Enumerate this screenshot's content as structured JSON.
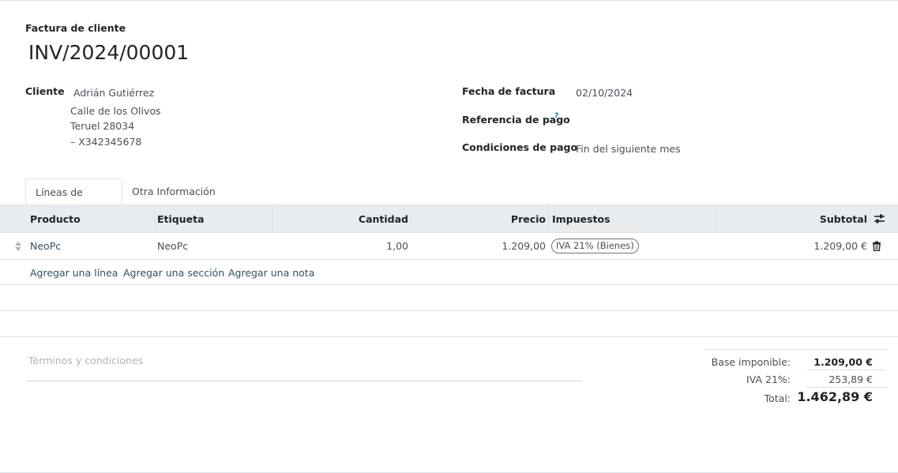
{
  "header": {
    "doc_type": "Factura de cliente",
    "doc_number": "INV/2024/00001"
  },
  "customer": {
    "label": "Cliente",
    "name": "Adrián Gutiérrez",
    "address_line1": "Calle de los Olivos",
    "address_line2": "Teruel 28034",
    "address_line3": "– X342345678"
  },
  "invoice_info": {
    "date_label": "Fecha de factura",
    "date_value": "02/10/2024",
    "payment_ref_label": "Referencia de pago",
    "payment_ref_help": "?",
    "payment_terms_label": "Condiciones de pago",
    "payment_terms_value": "Fin del siguiente mes"
  },
  "tabs": [
    {
      "label": "Líneas de factura",
      "active": true
    },
    {
      "label": "Otra Información",
      "active": false
    }
  ],
  "table": {
    "columns": [
      "Producto",
      "Etiqueta",
      "Cantidad",
      "Precio",
      "Impuestos",
      "Subtotal"
    ],
    "rows": [
      {
        "product": "NeoPc",
        "label": "NeoPc",
        "quantity": "1,00",
        "price": "1.209,00",
        "tax": "IVA 21% (Bienes)",
        "subtotal": "1.209,00 €"
      }
    ],
    "actions": [
      "Agregar una línea",
      "Agregar una sección",
      "Agregar una nota"
    ]
  },
  "terms": {
    "placeholder": "Términos y condiciones"
  },
  "totals": {
    "untaxed_label": "Base imponible:",
    "untaxed_value": "1.209,00 €",
    "tax_label": "IVA 21%:",
    "tax_value": "253,89 €",
    "total_label": "Total:",
    "total_value": "1.462,89 €"
  },
  "colors": {
    "accent": "#017e84",
    "header_bg": "#e9ecef",
    "border": "#dee2e6"
  }
}
